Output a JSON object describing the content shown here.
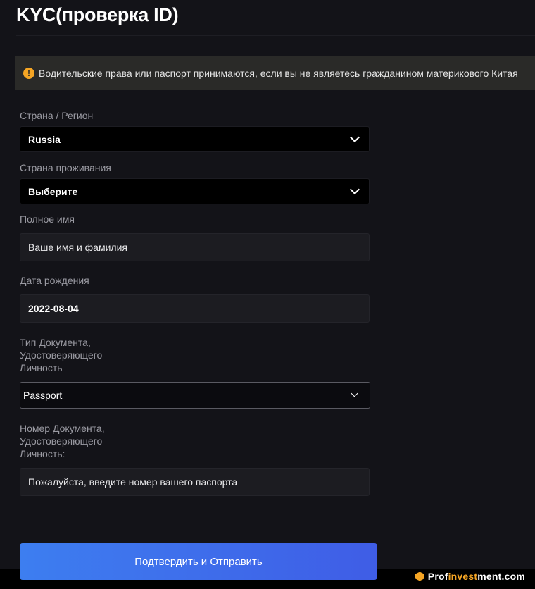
{
  "page": {
    "title": "KYC(проверка ID)"
  },
  "notice": {
    "icon": "warning-icon",
    "text": "Водительские права или паспорт принимаются, если вы не являетесь гражданином материкового Китая"
  },
  "form": {
    "country_label": "Страна / Регион",
    "country_value": "Russia",
    "residence_label": "Страна проживания",
    "residence_value": "Выберите",
    "fullname_label": "Полное имя",
    "fullname_placeholder": "Ваше имя и фамилия",
    "dob_label": "Дата рождения",
    "dob_value": "2022-08-04",
    "doc_type_label_lines": [
      "Тип Документа,",
      "Удостоверяющего",
      "Личность"
    ],
    "doc_type_value": "Passport",
    "doc_number_label_lines": [
      "Номер Документа,",
      "Удостоверяющего",
      "Личность:"
    ],
    "doc_number_placeholder": "Пожалуйста, введите номер вашего паспорта",
    "submit_label": "Подтвердить и Отправить"
  },
  "watermark": {
    "part1": "Prof",
    "part2": "invest",
    "part3": "ment.com"
  },
  "colors": {
    "accent_start": "#3d7ef0",
    "accent_end": "#3f5de6",
    "warning": "#f5a524",
    "background": "#131318"
  }
}
